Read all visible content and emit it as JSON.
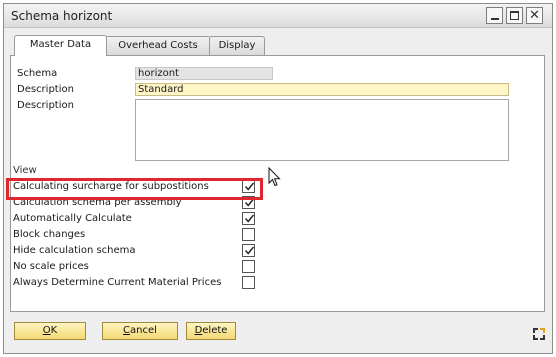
{
  "window": {
    "title": "Schema horizont"
  },
  "tabs": [
    {
      "label": "Master Data",
      "active": true
    },
    {
      "label": "Overhead Costs",
      "active": false
    },
    {
      "label": "Display",
      "active": false
    }
  ],
  "fields": {
    "schema_label": "Schema",
    "schema_value": "horizont",
    "description_label": "Description",
    "description_value": "Standard",
    "description2_label": "Description",
    "description2_value": ""
  },
  "view": {
    "label": "View",
    "options": [
      {
        "label": "Calculating surcharge for subpostitions",
        "checked": true
      },
      {
        "label": "Calculation schema per assembly",
        "checked": true
      },
      {
        "label": "Automatically Calculate",
        "checked": true
      },
      {
        "label": "Block changes",
        "checked": false
      },
      {
        "label": "Hide calculation schema",
        "checked": true
      },
      {
        "label": "No scale prices",
        "checked": false
      },
      {
        "label": "Always Determine Current Material Prices",
        "checked": false
      }
    ]
  },
  "buttons": {
    "ok_first": "O",
    "ok_rest": "K",
    "cancel_first": "C",
    "cancel_rest": "ancel",
    "delete_first": "D",
    "delete_rest": "elete"
  },
  "colors": {
    "highlight": "#e0262e",
    "button": "#f2d873",
    "mandatory_field": "#fff6c8"
  },
  "icons": {
    "corner": "resize-corner-icon",
    "cursor": "mouse-pointer-icon"
  }
}
